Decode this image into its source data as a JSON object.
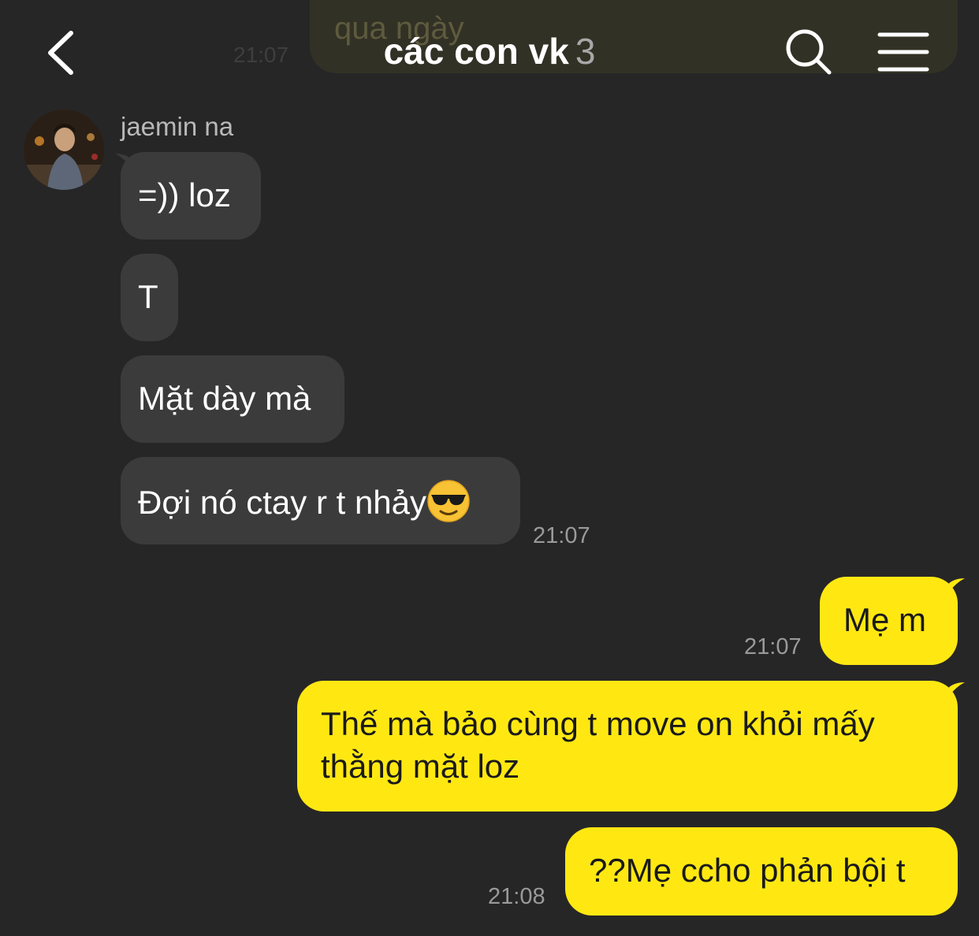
{
  "header": {
    "title": "các con vk",
    "member_count": "3"
  },
  "ghost": {
    "text": "qua ngày",
    "time": "21:07"
  },
  "messages_in": {
    "sender": "jaemin na",
    "m1": "=)) loz",
    "m2": "T",
    "m3": "Mặt dày mà",
    "m4": "Đợi nó ctay r t nhảy",
    "m4_emoji": "smiling-face-with-sunglasses",
    "time": "21:07"
  },
  "messages_out": {
    "m1": "Mẹ m",
    "m1_time": "21:07",
    "m2_line1": "Thế mà bảo cùng t move on khỏi mấy",
    "m2_line2": "thằng mặt loz",
    "m3": "??Mẹ ccho phản bội t",
    "m3_time": "21:08"
  },
  "colors": {
    "background": "#262627",
    "incoming_bubble": "#3b3b3c",
    "outgoing_bubble": "#ffe812"
  }
}
